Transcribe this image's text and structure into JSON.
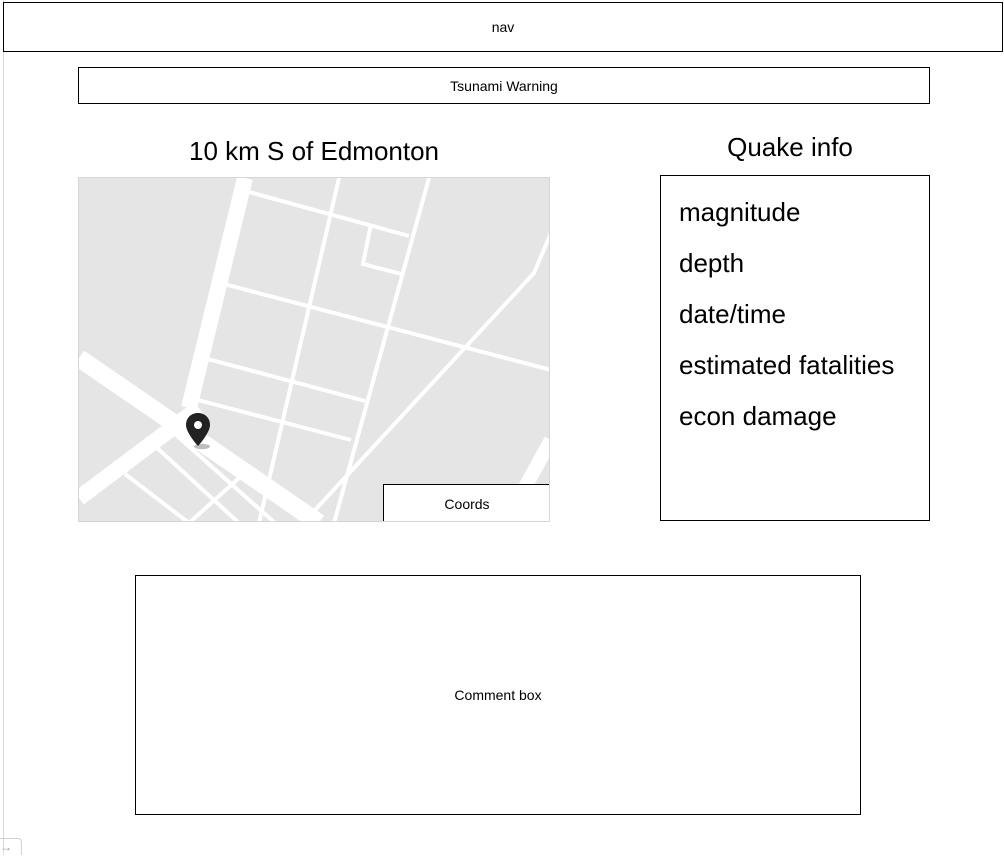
{
  "nav": {
    "label": "nav"
  },
  "banner": {
    "label": "Tsunami Warning"
  },
  "location": {
    "title": "10 km S of Edmonton"
  },
  "map": {
    "coords_label": "Coords",
    "pin_icon": "map-pin-icon",
    "background_color": "#e5e5e5",
    "road_color": "#ffffff"
  },
  "quake_info": {
    "title": "Quake info",
    "items": [
      "magnitude",
      "depth",
      "date/time",
      "estimated fatalities",
      "econ damage"
    ]
  },
  "comments": {
    "label": "Comment box"
  },
  "corner": {
    "icon": "arrow-right-icon"
  }
}
